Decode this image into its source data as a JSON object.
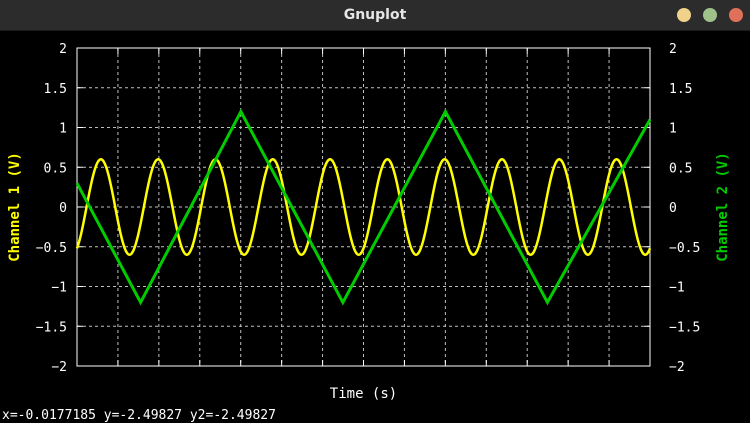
{
  "window": {
    "title": "Gnuplot",
    "buttons": [
      {
        "name": "minimize",
        "color": "#f0d28a"
      },
      {
        "name": "maximize",
        "color": "#9ec28a"
      },
      {
        "name": "close",
        "color": "#e0705a"
      }
    ]
  },
  "status": {
    "cursor_readout": "x=-0.0177185 y=-2.49827 y2=-2.49827"
  },
  "colors": {
    "background": "#000000",
    "axes": "#ffffff",
    "grid": "#bfbfbf",
    "channel1": "#ffff00",
    "channel2": "#00cc00"
  },
  "chart_data": {
    "type": "line",
    "title": "",
    "xlabel": "Time (s)",
    "ylabel": "Channel 1 (V)",
    "y2label": "Channel 2 (V)",
    "xlim": [
      0,
      1
    ],
    "ylim": [
      -2,
      2
    ],
    "y2lim": [
      -2,
      2
    ],
    "yticks": [
      "2",
      "1.5",
      "1",
      "0.5",
      "0",
      "−0.5",
      "−1",
      "−1.5",
      "−2"
    ],
    "y2ticks": [
      "2",
      "1.5",
      "1",
      "0.5",
      "0",
      "−0.5",
      "−1",
      "−1.5",
      "−2"
    ],
    "x_grid_divisions": 14,
    "grid": true,
    "legend": "none",
    "series": [
      {
        "name": "Channel 1 (V)",
        "axis": "y",
        "shape": "sine",
        "amplitude": 0.6,
        "cycles": 10,
        "phase_deg": -60,
        "offset": 0
      },
      {
        "name": "Channel 2 (V)",
        "axis": "y2",
        "shape": "triangle",
        "points": [
          {
            "x": 0.0,
            "y": 0.3
          },
          {
            "x": 0.111,
            "y": -1.2
          },
          {
            "x": 0.286,
            "y": 1.2
          },
          {
            "x": 0.464,
            "y": -1.2
          },
          {
            "x": 0.643,
            "y": 1.2
          },
          {
            "x": 0.821,
            "y": -1.2
          },
          {
            "x": 1.0,
            "y": 1.1
          }
        ]
      }
    ]
  }
}
